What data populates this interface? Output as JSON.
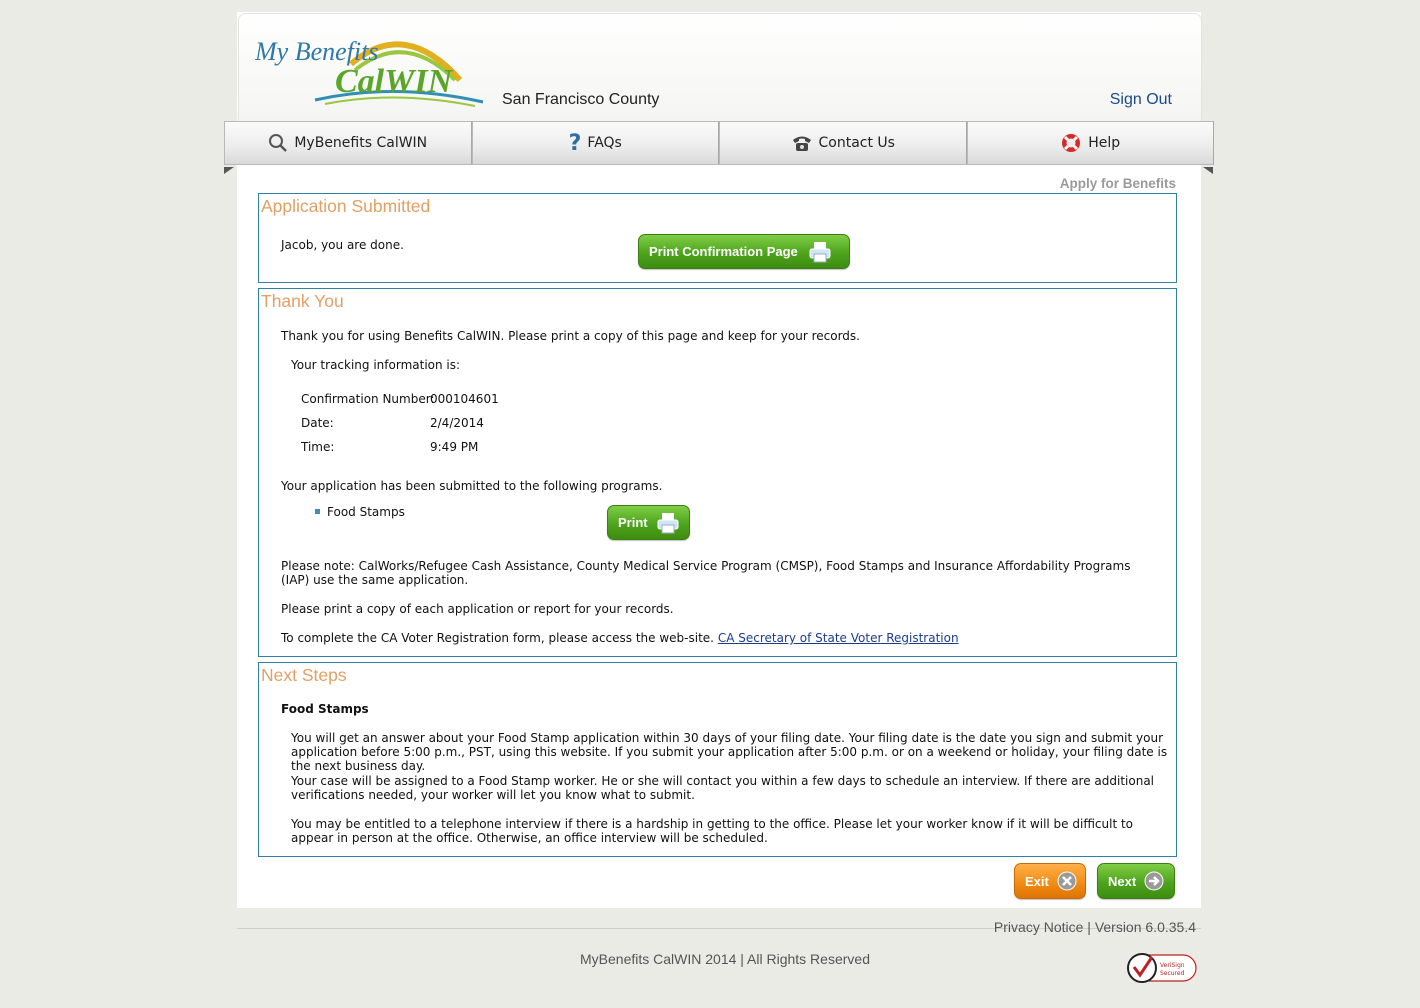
{
  "header": {
    "logo_text_1": "My Benefits",
    "logo_text_2": "CalWIN",
    "county": "San Francisco County",
    "sign_out": "Sign Out"
  },
  "nav": {
    "tabs": [
      {
        "label": "MyBenefits CalWIN",
        "icon": "search-icon"
      },
      {
        "label": "FAQs",
        "icon": "question-icon"
      },
      {
        "label": "Contact Us",
        "icon": "phone-icon"
      },
      {
        "label": "Help",
        "icon": "lifebuoy-icon"
      }
    ]
  },
  "breadcrumb": "Apply for Benefits",
  "submitted": {
    "title": "Application Submitted",
    "message": "Jacob, you are done.",
    "print_button": "Print Confirmation Page"
  },
  "thanks": {
    "title": "Thank You",
    "intro": "Thank you for using Benefits CalWIN.   Please print a copy of this page and keep for your records.",
    "tracking_intro": "Your tracking information is:",
    "tracking": {
      "confirmation_label": "Confirmation Number:",
      "confirmation_value": "000104601",
      "date_label": "Date:",
      "date_value": "2/4/2014",
      "time_label": "Time:",
      "time_value": "9:49 PM"
    },
    "programs_intro": "Your application has been submitted to the following programs.",
    "programs": [
      "Food Stamps"
    ],
    "print_button": "Print",
    "note": "Please note: CalWorks/Refugee Cash Assistance, County Medical Service Program (CMSP), Food Stamps and Insurance Affordability Programs (IAP) use the same application.",
    "print_note": "Please print a copy of each application or report for your records.",
    "voter_text": "To complete the CA Voter Registration form, please access the web-site.",
    "voter_link": "CA Secretary of State Voter Registration"
  },
  "next_steps": {
    "title": "Next Steps",
    "program": "Food Stamps",
    "p1": "You will get an answer about your Food Stamp application within 30 days of your filing date. Your filing date is the date you sign and submit your application before 5:00 p.m., PST, using this website.   If you submit your application after 5:00 p.m. or on a weekend or holiday, your filing date is the next business day.",
    "p2": "Your case will be assigned to a Food Stamp worker. He or she will contact you within a few days to schedule an interview. If there are additional verifications needed, your worker will let you know what to submit.",
    "p3": "You may be entitled to a telephone interview if there is a hardship in getting to the office. Please let your worker know if it will be difficult to appear in person at the office. Otherwise, an office interview will be scheduled."
  },
  "actions": {
    "exit": "Exit",
    "next": "Next"
  },
  "footer": {
    "privacy": "Privacy Notice",
    "sep": " | ",
    "version": "Version  6.0.35.4",
    "copyright": "MyBenefits CalWIN 2014 | All Rights Reserved",
    "seal_1": "VeriSign",
    "seal_2": "Secured"
  },
  "colors": {
    "panel_border": "#2f7fa6",
    "panel_title": "#e3a065",
    "green_button": "#4ea41d",
    "orange_button": "#f08a12",
    "link": "#1a3d8f"
  }
}
